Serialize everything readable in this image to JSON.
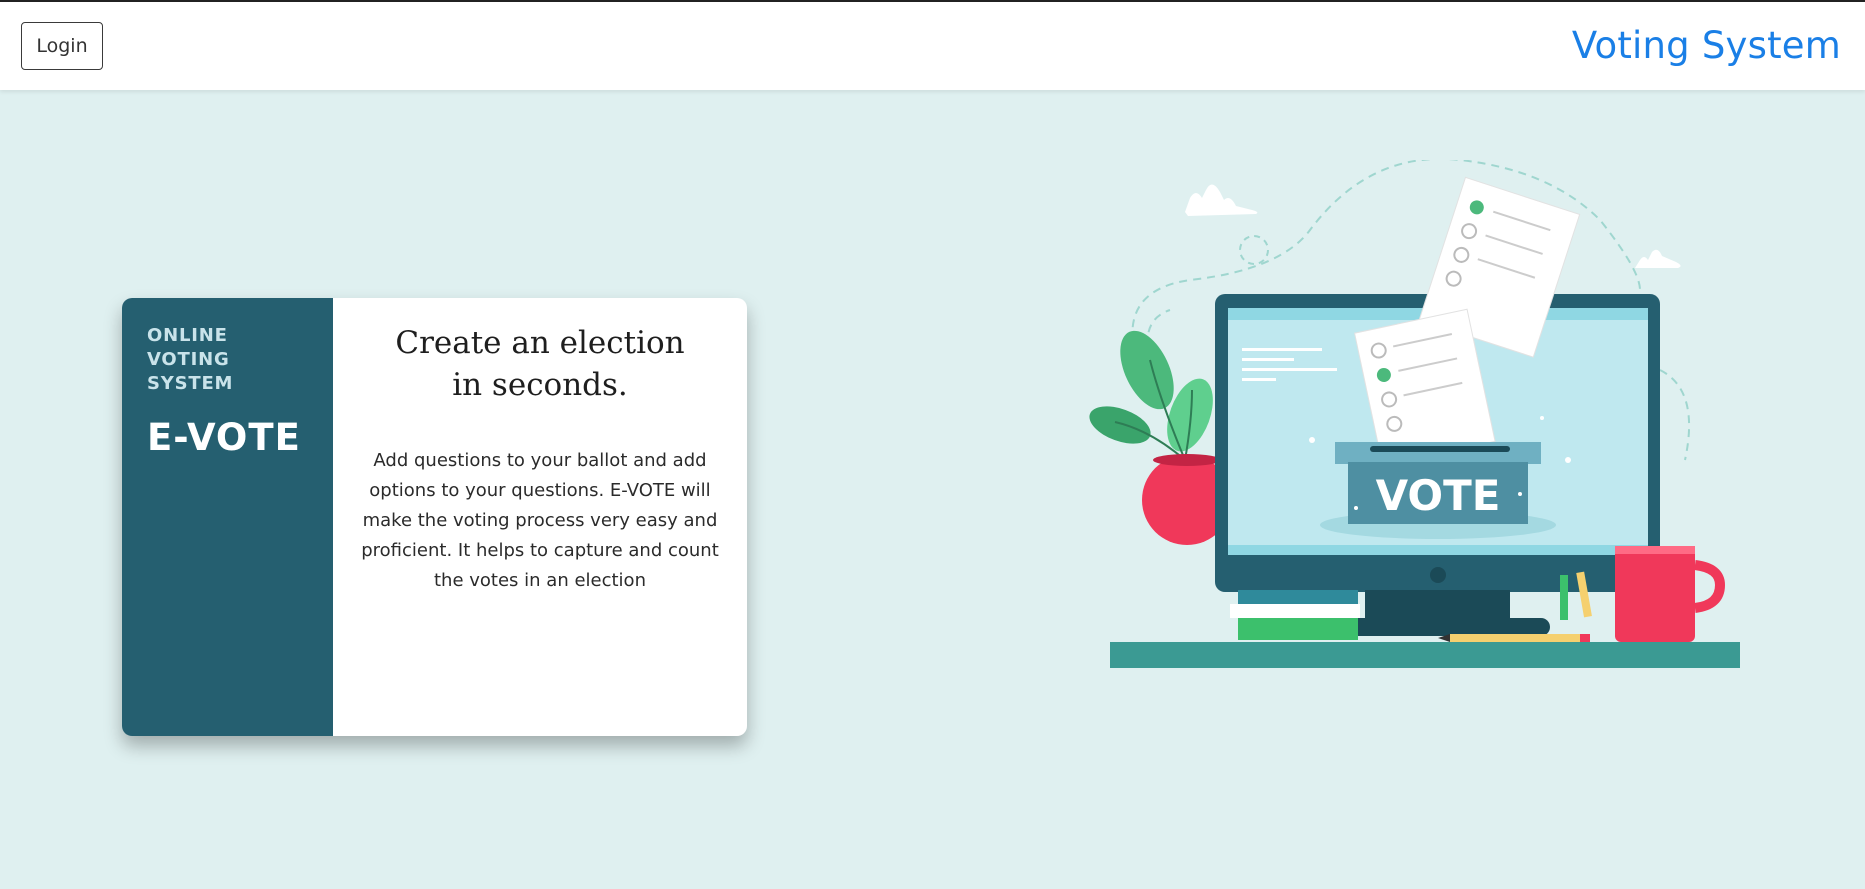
{
  "navbar": {
    "login_label": "Login",
    "brand": "Voting System"
  },
  "card": {
    "eyebrow": "ONLINE VOTING SYSTEM",
    "title": "E-VOTE",
    "headline": "Create an election in seconds.",
    "description": "Add questions to your ballot and add options to your questions. E-VOTE will make the voting process very easy and proficient. It helps to capture and count the votes in an election"
  },
  "illustration": {
    "ballot_box_label": "VOTE"
  },
  "colors": {
    "page_background": "#dff0f0",
    "brand": "#1a7fe6",
    "card_sidebar": "#255f70"
  }
}
